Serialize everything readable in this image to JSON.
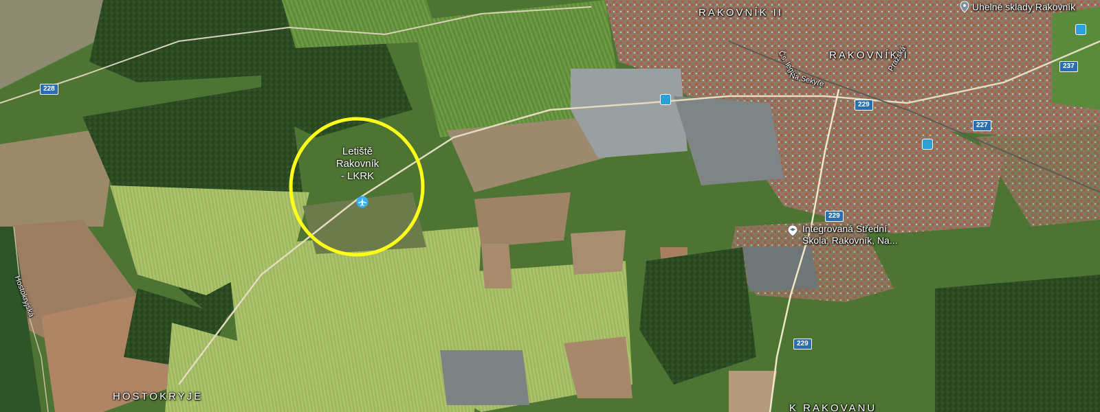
{
  "map": {
    "labels": {
      "rakovnik2": "RAKOVNÍK II",
      "rakovnik1": "RAKOVNÍK I",
      "hostokryje": "HOSTOKRYJE",
      "krakovanu": "K RAKOVANU",
      "hostokryjska": "Hostokryjská",
      "cs_legii": "Čs. legií",
      "na_sekyre": "Na Sekyře",
      "prazska": "Pražská"
    },
    "pois": {
      "airport_line1": "Letiště",
      "airport_line2": "Rakovník",
      "airport_line3": "- LKRK",
      "school_line1": "Integrovaná Střední",
      "school_line2": "Škola, Rakovník, Na...",
      "coal": "Uhelné sklady Rakovník"
    },
    "roads": {
      "r228": "228",
      "r229a": "229",
      "r229b": "229",
      "r229c": "229",
      "r227": "227",
      "r237": "237"
    },
    "colors": {
      "highlight_circle": "#ffff1a",
      "airport_icon": "#3ab0f0",
      "route_shield": "#2b6fb3"
    }
  }
}
